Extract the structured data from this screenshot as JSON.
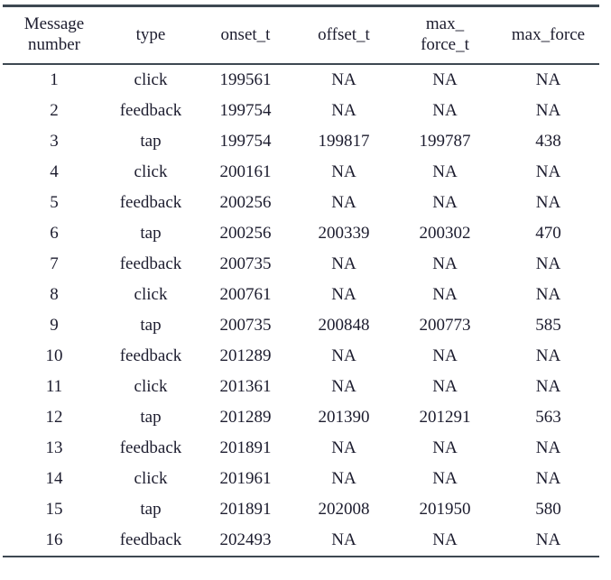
{
  "table": {
    "columns": [
      {
        "id": "message_number",
        "label_lines": [
          "Message",
          "number"
        ]
      },
      {
        "id": "type",
        "label_lines": [
          "type"
        ]
      },
      {
        "id": "onset_t",
        "label_lines": [
          "onset_t"
        ]
      },
      {
        "id": "offset_t",
        "label_lines": [
          "offset_t"
        ]
      },
      {
        "id": "max_force_t",
        "label_lines": [
          "max_",
          "force_t"
        ]
      },
      {
        "id": "max_force",
        "label_lines": [
          "max_force"
        ]
      }
    ],
    "rows": [
      {
        "message_number": "1",
        "type": "click",
        "onset_t": "199561",
        "offset_t": "NA",
        "max_force_t": "NA",
        "max_force": "NA"
      },
      {
        "message_number": "2",
        "type": "feedback",
        "onset_t": "199754",
        "offset_t": "NA",
        "max_force_t": "NA",
        "max_force": "NA"
      },
      {
        "message_number": "3",
        "type": "tap",
        "onset_t": "199754",
        "offset_t": "199817",
        "max_force_t": "199787",
        "max_force": "438"
      },
      {
        "message_number": "4",
        "type": "click",
        "onset_t": "200161",
        "offset_t": "NA",
        "max_force_t": "NA",
        "max_force": "NA"
      },
      {
        "message_number": "5",
        "type": "feedback",
        "onset_t": "200256",
        "offset_t": "NA",
        "max_force_t": "NA",
        "max_force": "NA"
      },
      {
        "message_number": "6",
        "type": "tap",
        "onset_t": "200256",
        "offset_t": "200339",
        "max_force_t": "200302",
        "max_force": "470"
      },
      {
        "message_number": "7",
        "type": "feedback",
        "onset_t": "200735",
        "offset_t": "NA",
        "max_force_t": "NA",
        "max_force": "NA"
      },
      {
        "message_number": "8",
        "type": "click",
        "onset_t": "200761",
        "offset_t": "NA",
        "max_force_t": "NA",
        "max_force": "NA"
      },
      {
        "message_number": "9",
        "type": "tap",
        "onset_t": "200735",
        "offset_t": "200848",
        "max_force_t": "200773",
        "max_force": "585"
      },
      {
        "message_number": "10",
        "type": "feedback",
        "onset_t": "201289",
        "offset_t": "NA",
        "max_force_t": "NA",
        "max_force": "NA"
      },
      {
        "message_number": "11",
        "type": "click",
        "onset_t": "201361",
        "offset_t": "NA",
        "max_force_t": "NA",
        "max_force": "NA"
      },
      {
        "message_number": "12",
        "type": "tap",
        "onset_t": "201289",
        "offset_t": "201390",
        "max_force_t": "201291",
        "max_force": "563"
      },
      {
        "message_number": "13",
        "type": "feedback",
        "onset_t": "201891",
        "offset_t": "NA",
        "max_force_t": "NA",
        "max_force": "NA"
      },
      {
        "message_number": "14",
        "type": "click",
        "onset_t": "201961",
        "offset_t": "NA",
        "max_force_t": "NA",
        "max_force": "NA"
      },
      {
        "message_number": "15",
        "type": "tap",
        "onset_t": "201891",
        "offset_t": "202008",
        "max_force_t": "201950",
        "max_force": "580"
      },
      {
        "message_number": "16",
        "type": "feedback",
        "onset_t": "202493",
        "offset_t": "NA",
        "max_force_t": "NA",
        "max_force": "NA"
      }
    ]
  },
  "style": {
    "rule_color": "#3d4852",
    "text_color": "#1c1c2e",
    "background": "#ffffff"
  }
}
